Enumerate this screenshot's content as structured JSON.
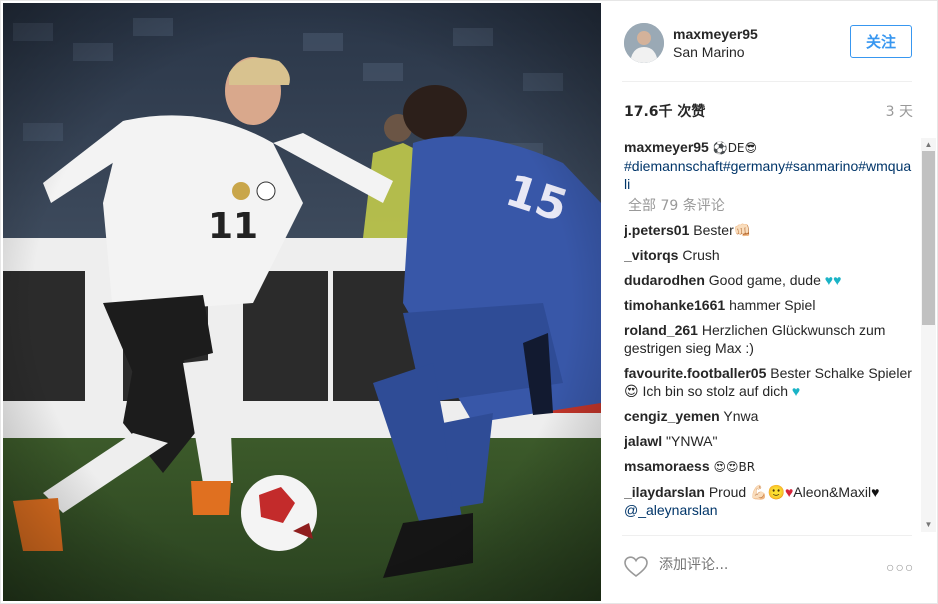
{
  "post": {
    "username": "maxmeyer95",
    "location": "San Marino",
    "follow_label": "关注",
    "likes": "17.6千 次赞",
    "time": "3 天"
  },
  "caption": {
    "username": "maxmeyer95",
    "text_suffix": "⚽DE😎",
    "hashtags": "#diemannschaft#germany#sanmarino#wmquali"
  },
  "all_comments_label": "全部 79 条评论",
  "comments": [
    {
      "user": "j.peters01",
      "text": "Bester👊🏻"
    },
    {
      "user": "_vitorqs",
      "text": "Crush"
    },
    {
      "user": "dudarodhen",
      "text": "Good game, dude",
      "hearts": "♥♥"
    },
    {
      "user": "timohanke1661",
      "text": "hammer Spiel"
    },
    {
      "user": "roland_261",
      "text": "Herzlichen Glückwunsch zum gestrigen sieg Max :)"
    },
    {
      "user": "favourite.footballer05",
      "text": "Bester Schalke Spieler😍 Ich bin so stolz auf dich",
      "heart": "♥"
    },
    {
      "user": "cengiz_yemen",
      "text": "Ynwa"
    },
    {
      "user": "jalawl",
      "text": "\"YNWA\""
    },
    {
      "user": "msamoraess",
      "text": "😍😍BR"
    },
    {
      "user": "_ilaydarslan",
      "text_a": "Proud 💪🏻🙂",
      "text_b": "Aleon&Maxil",
      "mention": "@_aleynarslan"
    }
  ],
  "add_comment_placeholder": "添加评论...",
  "icons": {
    "like": "heart-outline-icon",
    "more": "more-options-icon"
  },
  "colors": {
    "link": "#003569",
    "follow": "#3897f0",
    "muted": "#999999"
  }
}
